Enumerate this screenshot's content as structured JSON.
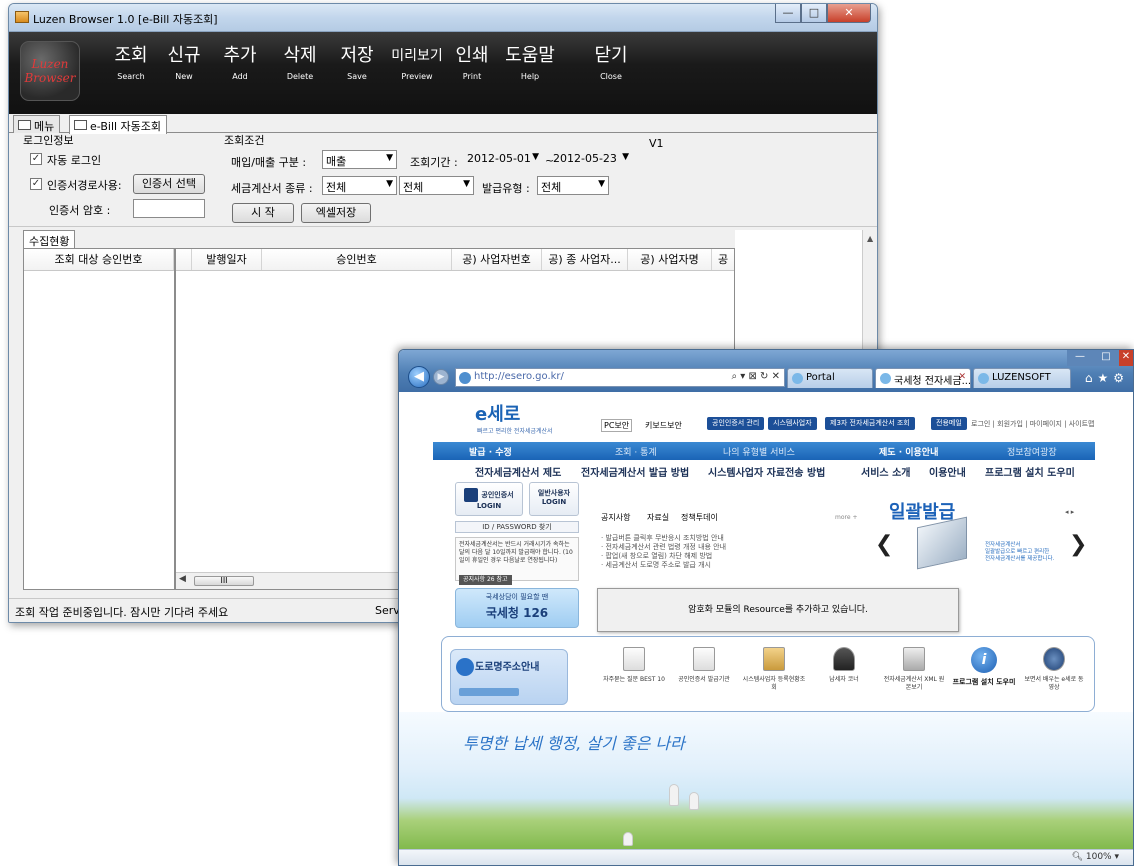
{
  "luzen": {
    "title": "Luzen Browser 1.0 [e-Bill 자동조회]",
    "logo": "Luzen Browser",
    "toolbar": [
      {
        "ko": "조회",
        "en": "Search"
      },
      {
        "ko": "신규",
        "en": "New"
      },
      {
        "ko": "추가",
        "en": "Add"
      },
      {
        "ko": "삭제",
        "en": "Delete"
      },
      {
        "ko": "저장",
        "en": "Save"
      },
      {
        "ko": "미리보기",
        "en": "Preview"
      },
      {
        "ko": "인쇄",
        "en": "Print"
      },
      {
        "ko": "도움말",
        "en": "Help"
      },
      {
        "ko": "닫기",
        "en": "Close"
      }
    ],
    "tabs": [
      "메뉴",
      "e-Bill 자동조회"
    ],
    "login_group": {
      "title": "로그인정보",
      "auto_login": "자동 로그인",
      "cert_path": "인증서경로사용:",
      "cert_button": "인증서 선택",
      "cert_password": "인증서 암호 :"
    },
    "query_group": {
      "title": "조회조건",
      "buy_sell_label": "매입/매출 구분 :",
      "buy_sell_value": "매출",
      "period_label": "조회기간 :",
      "date_from": "2012-05-01",
      "tilde": "~",
      "date_to": "2012-05-23",
      "invoice_type_label": "세금계산서 종류 :",
      "invoice_type_value": "전체",
      "invoice_sub_value": "전체",
      "issue_type_label": "발급유형 :",
      "issue_type_value": "전체",
      "start_button": "시 작",
      "excel_button": "엑셀저장",
      "version": "V1"
    },
    "collect_tab": "수집현황",
    "left_header": "조회 대상 승인번호",
    "columns": [
      "발행일자",
      "승인번호",
      "공) 사업자번호",
      "공) 종 사업자...",
      "공) 사업자명",
      "공"
    ],
    "hscroll_mark": "III",
    "status": "조회 작업 준비중입니다. 잠시만 기다려 주세요",
    "status_right": "Servi"
  },
  "ie": {
    "address": "http://esero.go.kr/",
    "address_tools": "⌕ ▾ ⊠ ↻ ✕",
    "tabs": [
      "Portal",
      "국세청 전자세금...",
      "LUZENSOFT"
    ],
    "zoom": "100%",
    "loading_message": "암호화 모듈의 Resource를 추가하고 있습니다."
  },
  "esero": {
    "logo": "e세로",
    "logo_sub": "빠르고 편리한 전자세금계산서",
    "badges": [
      "PC보안",
      "키보드보안"
    ],
    "pills": [
      "공인인증서 관리",
      "시스템사업자",
      "제3자 전자세금계산서 조회",
      "전용메일"
    ],
    "toplinks": "로그인 | 회원가입 | 마이페이지 | 사이트맵",
    "main_nav": [
      "발급 · 수정",
      "조회 · 통계",
      "나의 유형별 서비스",
      "제도 · 이용안내",
      "정보참여광장"
    ],
    "sub_nav": [
      "전자세금계산서 제도",
      "전자세금계산서 발급 방법",
      "시스템사업자 자료전송 방법",
      "서비스 소개",
      "이용안내",
      "프로그램 설치 도우미"
    ],
    "login_cert": "공인인증서 LOGIN",
    "login_general": "일반사용자 LOGIN",
    "idpw": "ID / PASSWORD 찾기",
    "notice_text": "전자세금계산서는 반드시 거래시기가 속하는 달의 다음 달 10일까지 발급해야 합니다. (10일이 휴일인 경우 다음날로 연장됩니다)",
    "notice_tag": "공지사항 26 참고",
    "banner_small": "국세상담이 필요할 땐",
    "banner_big": "국세청 126",
    "notice_tabs": [
      "공지사항",
      "자료실",
      "정책투데이"
    ],
    "more": "more +",
    "notice_list": [
      "· 발급버튼 클릭후 무반응시 조치방법 안내",
      "· 전자세금계산서 관련 법령 개정 내용 안내",
      "· 팝업(새 창으로 열림) 차단 해제 방법",
      "· 세금계산서 도로명 주소로 발급 개시"
    ],
    "slider_title": "일괄발급",
    "slider_desc": [
      "전자세금계산서",
      "일괄발급으로 빠르고 편리한",
      "전자세금계산서를 제공합니다."
    ],
    "road_title": "도로명주소안내",
    "quick_items": [
      "자주묻는 질문 BEST 10",
      "공인인증서 발급기관",
      "시스템사업자 등록현황조회",
      "납세자 코너",
      "전자세금계산서 XML 원본보기",
      "프로그램 설치 도우미",
      "보면서 배우는 e세로 동영상"
    ],
    "slogan": "투명한 납세 행정, 살기 좋은 나라"
  }
}
